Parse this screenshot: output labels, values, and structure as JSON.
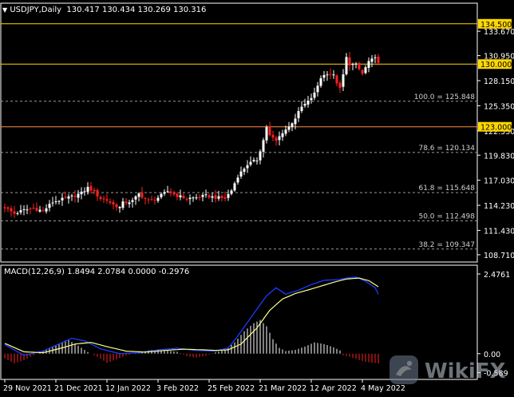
{
  "header": {
    "symbol_label": "USDJPY,Daily",
    "ohlc_label": "130.417 130.434 130.269 130.316"
  },
  "macd_header": {
    "label": "MACD(12,26,9) 1.8494 2.0784 0.0000 -0.2976"
  },
  "watermark": {
    "text": "WikiFX"
  },
  "colors": {
    "background": "#000000",
    "axis": "#ffffff",
    "bull_candle": "#ffffff",
    "bear_candle": "#ff2020",
    "level_line_yellow": "#ffd700",
    "level_line_orange": "#ff8c3a",
    "fib_dash": "#9a9a9a",
    "macd_line": "#1a3cff",
    "signal_line": "#ffff8a",
    "hist_pos": "#ffffff",
    "hist_neg": "#ff2020"
  },
  "chart_data": [
    {
      "type": "candlestick",
      "title": "USDJPY,Daily",
      "ylim": [
        107.9,
        136.8
      ],
      "price_ticks": [
        "133.670",
        "130.950",
        "128.150",
        "125.350",
        "122.550",
        "119.830",
        "117.030",
        "114.230",
        "111.430",
        "108.710"
      ],
      "x_labels": [
        "29 Nov 2021",
        "21 Dec 2021",
        "12 Jan 2022",
        "3 Feb 2022",
        "25 Feb 2022",
        "21 Mar 2022",
        "12 Apr 2022",
        "4 May 2022"
      ],
      "x_label_index": [
        0,
        16,
        32,
        48,
        64,
        80,
        96,
        112
      ],
      "levels": [
        {
          "value": 134.5,
          "label": "134.500",
          "style": "solid",
          "color": "yellow",
          "box": true
        },
        {
          "value": 130.0,
          "label": "130.000",
          "style": "solid",
          "color": "yellow",
          "box": true
        },
        {
          "value": 123.0,
          "label": "123.000",
          "style": "solid",
          "color": "orange",
          "box": true
        },
        {
          "value": 125.848,
          "label": "100.0 = 125.848",
          "style": "dashed"
        },
        {
          "value": 120.134,
          "label": "78.6 = 120.134",
          "style": "dashed"
        },
        {
          "value": 115.648,
          "label": "61.8 = 115.648",
          "style": "dashed"
        },
        {
          "value": 112.498,
          "label": "50.0 = 112.498",
          "style": "dashed"
        },
        {
          "value": 109.347,
          "label": "38.2 = 109.347",
          "style": "dashed"
        }
      ],
      "close_anchors": [
        [
          0,
          114.0
        ],
        [
          3,
          113.3
        ],
        [
          6,
          113.7
        ],
        [
          9,
          113.9
        ],
        [
          12,
          113.6
        ],
        [
          15,
          114.6
        ],
        [
          18,
          114.9
        ],
        [
          21,
          115.2
        ],
        [
          24,
          115.6
        ],
        [
          26,
          116.2
        ],
        [
          27,
          116.0
        ],
        [
          30,
          115.0
        ],
        [
          32,
          114.8
        ],
        [
          34,
          114.3
        ],
        [
          36,
          114.0
        ],
        [
          37,
          114.5
        ],
        [
          40,
          114.7
        ],
        [
          42,
          115.5
        ],
        [
          45,
          114.7
        ],
        [
          48,
          115.1
        ],
        [
          51,
          115.8
        ],
        [
          54,
          115.3
        ],
        [
          57,
          115.0
        ],
        [
          60,
          115.1
        ],
        [
          63,
          115.3
        ],
        [
          66,
          115.1
        ],
        [
          69,
          115.0
        ],
        [
          71,
          115.9
        ],
        [
          73,
          117.5
        ],
        [
          76,
          118.8
        ],
        [
          79,
          119.3
        ],
        [
          81,
          121.5
        ],
        [
          82,
          123.0
        ],
        [
          83,
          122.0
        ],
        [
          85,
          121.4
        ],
        [
          87,
          122.4
        ],
        [
          89,
          123.0
        ],
        [
          91,
          124.0
        ],
        [
          93,
          125.2
        ],
        [
          95,
          125.8
        ],
        [
          97,
          126.7
        ],
        [
          99,
          128.5
        ],
        [
          101,
          129.0
        ],
        [
          103,
          128.7
        ],
        [
          105,
          127.2
        ],
        [
          106,
          128.8
        ],
        [
          107,
          130.7
        ],
        [
          108,
          130.0
        ],
        [
          110,
          129.9
        ],
        [
          112,
          128.9
        ],
        [
          114,
          130.3
        ],
        [
          116,
          130.6
        ],
        [
          117,
          130.3
        ]
      ],
      "macd": {
        "name": "MACD(12,26,9)",
        "ylim": [
          -0.8,
          2.75
        ],
        "ticks": [
          "2.4761",
          "0.00",
          "-0.589"
        ],
        "line_anchors": [
          [
            0,
            0.28
          ],
          [
            6,
            -0.05
          ],
          [
            12,
            0.08
          ],
          [
            18,
            0.35
          ],
          [
            21,
            0.48
          ],
          [
            25,
            0.4
          ],
          [
            30,
            0.15
          ],
          [
            36,
            0.0
          ],
          [
            42,
            0.03
          ],
          [
            48,
            0.12
          ],
          [
            54,
            0.17
          ],
          [
            60,
            0.1
          ],
          [
            66,
            0.08
          ],
          [
            70,
            0.18
          ],
          [
            73,
            0.55
          ],
          [
            78,
            1.25
          ],
          [
            82,
            1.8
          ],
          [
            85,
            2.05
          ],
          [
            88,
            1.85
          ],
          [
            92,
            1.97
          ],
          [
            96,
            2.15
          ],
          [
            100,
            2.28
          ],
          [
            104,
            2.3
          ],
          [
            107,
            2.35
          ],
          [
            110,
            2.38
          ],
          [
            113,
            2.25
          ],
          [
            116,
            2.05
          ],
          [
            117,
            1.85
          ]
        ],
        "signal_anchors": [
          [
            0,
            0.32
          ],
          [
            6,
            0.06
          ],
          [
            12,
            0.03
          ],
          [
            18,
            0.18
          ],
          [
            22,
            0.3
          ],
          [
            27,
            0.35
          ],
          [
            32,
            0.22
          ],
          [
            38,
            0.08
          ],
          [
            44,
            0.05
          ],
          [
            50,
            0.1
          ],
          [
            56,
            0.14
          ],
          [
            62,
            0.12
          ],
          [
            66,
            0.1
          ],
          [
            70,
            0.12
          ],
          [
            74,
            0.3
          ],
          [
            79,
            0.8
          ],
          [
            83,
            1.35
          ],
          [
            87,
            1.7
          ],
          [
            91,
            1.87
          ],
          [
            95,
            1.98
          ],
          [
            99,
            2.1
          ],
          [
            103,
            2.22
          ],
          [
            107,
            2.32
          ],
          [
            111,
            2.35
          ],
          [
            114,
            2.27
          ],
          [
            117,
            2.08
          ]
        ],
        "hist_anchors": [
          [
            0,
            -0.15
          ],
          [
            3,
            -0.3
          ],
          [
            6,
            -0.2
          ],
          [
            9,
            -0.05
          ],
          [
            12,
            0.1
          ],
          [
            15,
            0.2
          ],
          [
            18,
            0.35
          ],
          [
            20,
            0.42
          ],
          [
            23,
            0.25
          ],
          [
            26,
            0.05
          ],
          [
            29,
            -0.1
          ],
          [
            32,
            -0.28
          ],
          [
            35,
            -0.18
          ],
          [
            38,
            -0.06
          ],
          [
            42,
            0.05
          ],
          [
            46,
            0.12
          ],
          [
            50,
            0.1
          ],
          [
            54,
            0.06
          ],
          [
            57,
            -0.08
          ],
          [
            60,
            -0.12
          ],
          [
            63,
            -0.06
          ],
          [
            66,
            0.04
          ],
          [
            69,
            0.12
          ],
          [
            72,
            0.35
          ],
          [
            75,
            0.7
          ],
          [
            78,
            0.95
          ],
          [
            80,
            1.05
          ],
          [
            82,
            0.85
          ],
          [
            84,
            0.45
          ],
          [
            86,
            0.18
          ],
          [
            88,
            0.08
          ],
          [
            91,
            0.12
          ],
          [
            94,
            0.22
          ],
          [
            97,
            0.35
          ],
          [
            100,
            0.3
          ],
          [
            103,
            0.2
          ],
          [
            105,
            0.1
          ],
          [
            106,
            -0.05
          ],
          [
            108,
            -0.1
          ],
          [
            111,
            -0.2
          ],
          [
            113,
            -0.25
          ],
          [
            115,
            -0.28
          ],
          [
            117,
            -0.3
          ]
        ]
      },
      "n_candles": 118
    }
  ]
}
